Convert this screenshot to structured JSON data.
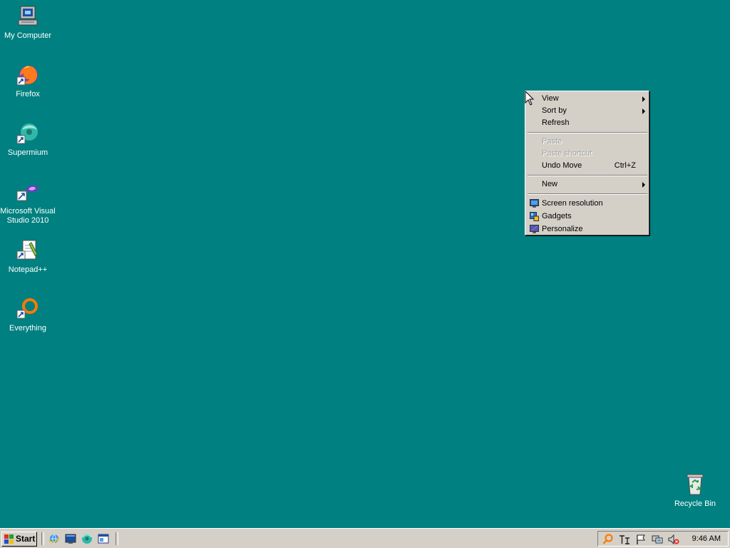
{
  "desktop": {
    "background": "#008080",
    "icons": [
      {
        "label": "My Computer",
        "icon": "computer-icon"
      },
      {
        "label": "Firefox",
        "icon": "firefox-icon"
      },
      {
        "label": "Supermium",
        "icon": "supermium-icon"
      },
      {
        "label_line1": "Microsoft Visual",
        "label_line2": "Studio 2010",
        "icon": "visual-studio-icon"
      },
      {
        "label": "Notepad++",
        "icon": "notepadplusplus-icon"
      },
      {
        "label": "Everything",
        "icon": "everything-icon"
      },
      {
        "label": "Recycle Bin",
        "icon": "recycle-bin-icon"
      }
    ]
  },
  "context_menu": {
    "items": {
      "view": {
        "label": "View",
        "submenu": true
      },
      "sort_by": {
        "label": "Sort by",
        "submenu": true
      },
      "refresh": {
        "label": "Refresh"
      },
      "paste": {
        "label": "Paste",
        "disabled": true
      },
      "paste_shortcut": {
        "label": "Paste shortcut",
        "disabled": true
      },
      "undo_move": {
        "label": "Undo Move",
        "shortcut": "Ctrl+Z"
      },
      "new": {
        "label": "New",
        "submenu": true
      },
      "screen_resolution": {
        "label": "Screen resolution",
        "icon": "monitor-icon"
      },
      "gadgets": {
        "label": "Gadgets",
        "icon": "gadgets-icon"
      },
      "personalize": {
        "label": "Personalize",
        "icon": "personalize-icon"
      }
    }
  },
  "taskbar": {
    "start_label": "Start",
    "quick_launch": [
      "internet-explorer-icon",
      "show-desktop-icon",
      "supermium-icon",
      "explorer-icon"
    ],
    "tray_icons": [
      "search-icon",
      "language-icon",
      "flag-icon",
      "network-icon",
      "volume-muted-icon"
    ],
    "clock": "9:46 AM"
  }
}
